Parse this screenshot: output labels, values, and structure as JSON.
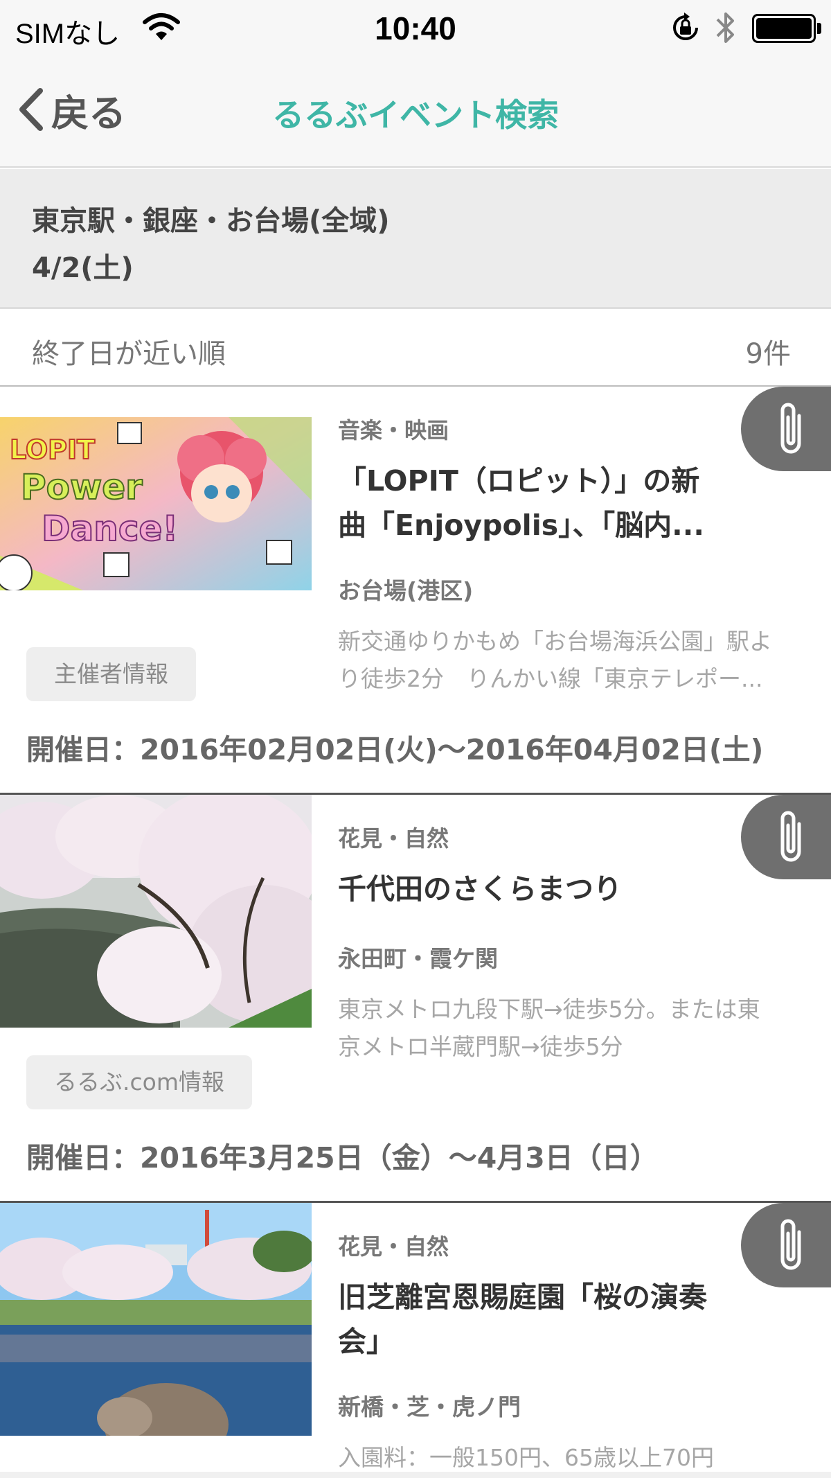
{
  "status_bar": {
    "carrier": "SIMなし",
    "time": "10:40",
    "icons": [
      "wifi-icon",
      "orientation-lock-icon",
      "bluetooth-icon",
      "battery-icon"
    ]
  },
  "nav": {
    "back_label": "戻る",
    "title": "るるぶイベント検索",
    "accent_color": "#3fb6a6"
  },
  "condition": {
    "area": "東京駅・銀座・お台場(全域)",
    "date": "4/2(土)"
  },
  "sort": {
    "label": "終了日が近い順",
    "count": "9件"
  },
  "events": [
    {
      "category": "音楽・映画",
      "title_line1": "「LOPIT（ロピット）」の新",
      "title_line2": "曲「Enjoypolis」、「脳内...",
      "location": "お台場(港区)",
      "access_line1": "新交通ゆりかもめ「お台場海浜公園」駅よ",
      "access_line2": "り徒歩2分　りんかい線「東京テレポー...",
      "info_button": "主催者情報",
      "period": "開催日：2016年02月02日(火)〜2016年04月02日(土)",
      "image_texts": [
        "LOPIT",
        "Power",
        "Dance!"
      ]
    },
    {
      "category": "花見・自然",
      "title_line1": "千代田のさくらまつり",
      "title_line2": "",
      "location": "永田町・霞ケ関",
      "access_line1": "東京メトロ九段下駅→徒歩5分。または東",
      "access_line2": "京メトロ半蔵門駅→徒歩5分",
      "info_button": "るるぶ.com情報",
      "period": "開催日：2016年3月25日（金）〜4月3日（日）"
    },
    {
      "category": "花見・自然",
      "title_line1": "旧芝離宮恩賜庭園「桜の演奏",
      "title_line2": "会」",
      "location": "新橋・芝・虎ノ門",
      "access_line1": "入園料：一般150円、65歳以上70円",
      "access_line2": ""
    }
  ]
}
